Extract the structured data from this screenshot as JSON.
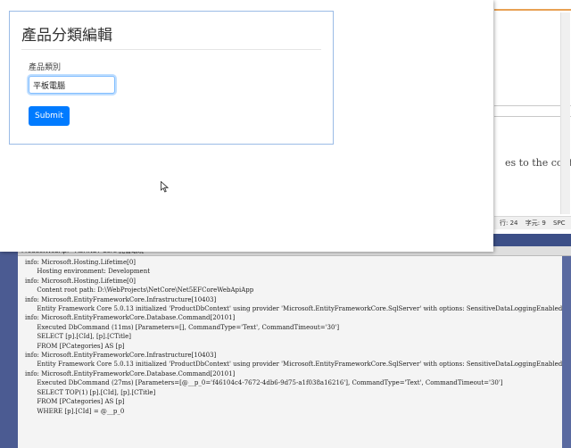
{
  "form": {
    "title": "產品分類編輯",
    "field_label": "產品類別",
    "field_value": "平板電腦",
    "submit_label": "Submit"
  },
  "editor": {
    "code_fragment": "es to the contai",
    "status": {
      "line": "行: 24",
      "col": "字元: 9",
      "mode": "SPC"
    }
  },
  "console": {
    "title": "ProductWebApi - ASP.NET Core 託管環境",
    "lines": [
      "info: Microsoft.Hosting.Lifetime[0]",
      "      Hosting environment: Development",
      "info: Microsoft.Hosting.Lifetime[0]",
      "      Content root path: D:\\WebProjects\\NetCore\\Net5EFCoreWebApiApp",
      "info: Microsoft.EntityFrameworkCore.Infrastructure[10403]",
      "      Entity Framework Core 5.0.13 initialized 'ProductDbContext' using provider 'Microsoft.EntityFrameworkCore.SqlServer' with options: SensitiveDataLoggingEnabled",
      "info: Microsoft.EntityFrameworkCore.Database.Command[20101]",
      "      Executed DbCommand (11ms) [Parameters=[], CommandType='Text', CommandTimeout='30']",
      "      SELECT [p].[CId], [p].[CTitle]",
      "      FROM [PCategories] AS [p]",
      "info: Microsoft.EntityFrameworkCore.Infrastructure[10403]",
      "      Entity Framework Core 5.0.13 initialized 'ProductDbContext' using provider 'Microsoft.EntityFrameworkCore.SqlServer' with options: SensitiveDataLoggingEnabled",
      "info: Microsoft.EntityFrameworkCore.Database.Command[20101]",
      "      Executed DbCommand (27ms) [Parameters=[@__p_0='f46104c4-7672-4db6-9d75-a1f038a16216'], CommandType='Text', CommandTimeout='30']",
      "      SELECT TOP(1) [p].[CId], [p].[CTitle]",
      "      FROM [PCategories] AS [p]",
      "      WHERE [p].[CId] = @__p_0"
    ]
  },
  "colors": {
    "primary": "#007bff",
    "card_border": "#9bbbe6",
    "taskbar": "#3c4f87"
  }
}
